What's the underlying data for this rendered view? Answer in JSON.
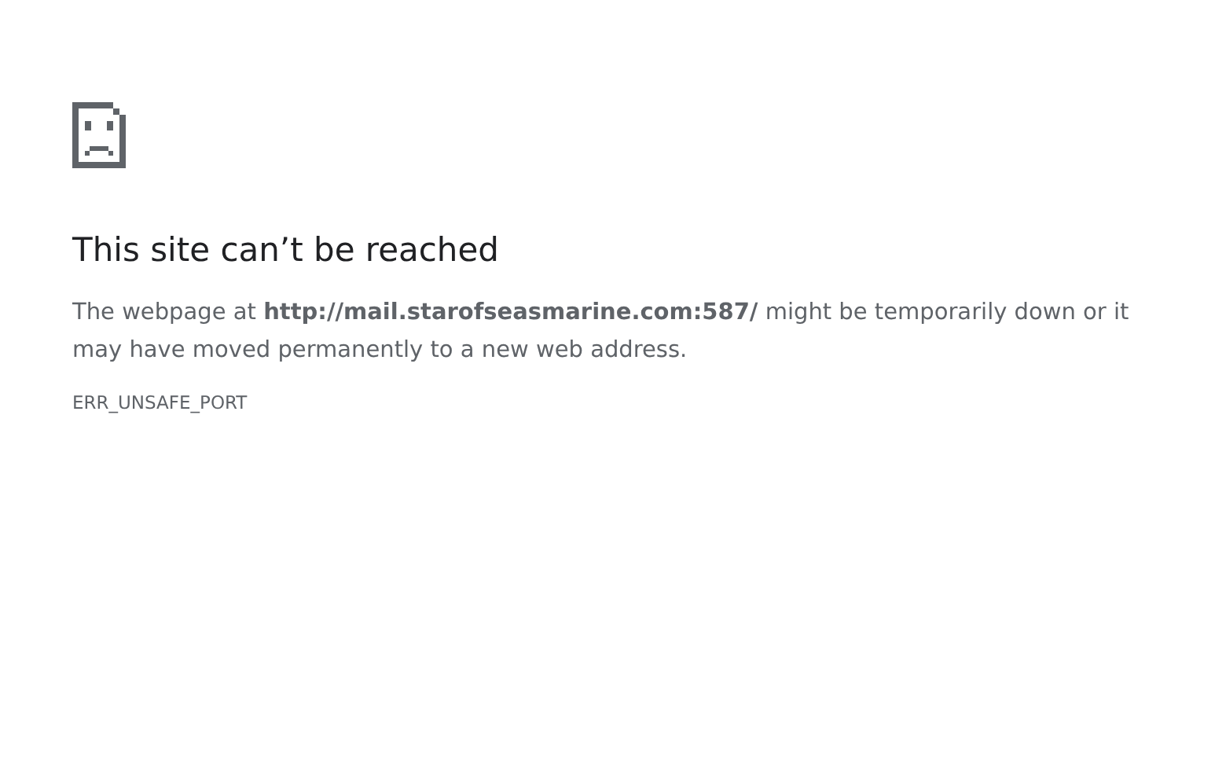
{
  "heading": "This site can’t be reached",
  "message": "The webpage at **http://mail.starofseasmarine.com:587/** might be temporarily down or it may have moved permanently to a new web address.",
  "error_code": "ERR_UNSAFE_PORT"
}
